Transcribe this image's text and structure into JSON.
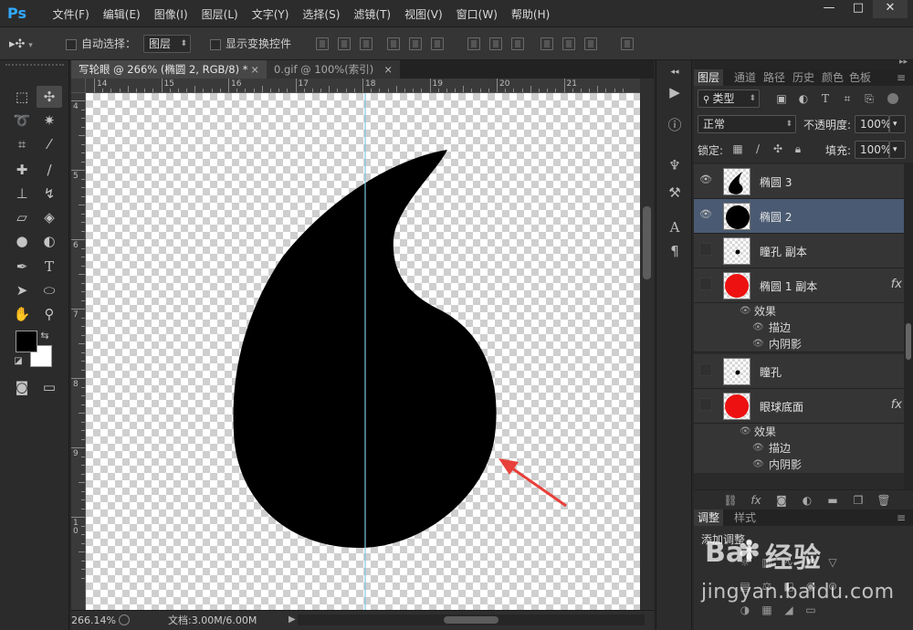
{
  "app": {
    "logo": "Ps"
  },
  "menu": [
    "文件(F)",
    "编辑(E)",
    "图像(I)",
    "图层(L)",
    "文字(Y)",
    "选择(S)",
    "滤镜(T)",
    "视图(V)",
    "窗口(W)",
    "帮助(H)"
  ],
  "window_controls": {
    "minimize": "—",
    "restore": "□",
    "close": "✕"
  },
  "options": {
    "auto_select_label": "自动选择：",
    "auto_select_value": "图层",
    "show_transform_label": "显示变换控件"
  },
  "doc_tabs": [
    {
      "label": "写轮眼 @ 266% (椭圆 2, RGB/8) *",
      "close": "×"
    },
    {
      "label": "0.gif @ 100%(索引)",
      "close": "×"
    }
  ],
  "ruler": {
    "h": [
      "14",
      "15",
      "16",
      "17",
      "18",
      "19",
      "20",
      "21"
    ],
    "v": [
      "4",
      "5",
      "6",
      "7",
      "8",
      "9",
      "10"
    ]
  },
  "status": {
    "zoom": "266.14%",
    "doc": "文档:3.00M/6.00M"
  },
  "layers_panel": {
    "tabs": [
      "图层",
      "通道",
      "路径",
      "历史",
      "颜色",
      "色板"
    ],
    "filter": "类型",
    "blend_mode": "正常",
    "opacity_label": "不透明度:",
    "opacity": "100%",
    "lock_label": "锁定:",
    "fill_label": "填充:",
    "fill": "100%",
    "layers": [
      {
        "name": "椭圆 3",
        "visible": true,
        "selected": false,
        "fx": false
      },
      {
        "name": "椭圆 2",
        "visible": true,
        "selected": true,
        "fx": false
      },
      {
        "name": "瞳孔 副本",
        "visible": false,
        "selected": false,
        "fx": false
      },
      {
        "name": "椭圆 1 副本",
        "visible": false,
        "selected": false,
        "fx": true,
        "effects_label": "效果",
        "effects": [
          "描边",
          "内阴影"
        ]
      },
      {
        "name": "瞳孔",
        "visible": false,
        "selected": false,
        "fx": false
      },
      {
        "name": "眼球底面",
        "visible": false,
        "selected": false,
        "fx": true,
        "effects_label": "效果",
        "effects": [
          "描边",
          "内阴影"
        ]
      }
    ],
    "fx_label": "fx"
  },
  "adjustments_panel": {
    "tabs": [
      "调整",
      "样式"
    ],
    "title": "添加调整"
  },
  "watermark": {
    "brand_a": "Bai",
    "brand_b": "经验",
    "url": "jingyan.baidu.com"
  },
  "colors": {
    "annotation_arrow": "#e8403a",
    "guide": "#7fc8e0",
    "selection": "#4a5a72"
  }
}
